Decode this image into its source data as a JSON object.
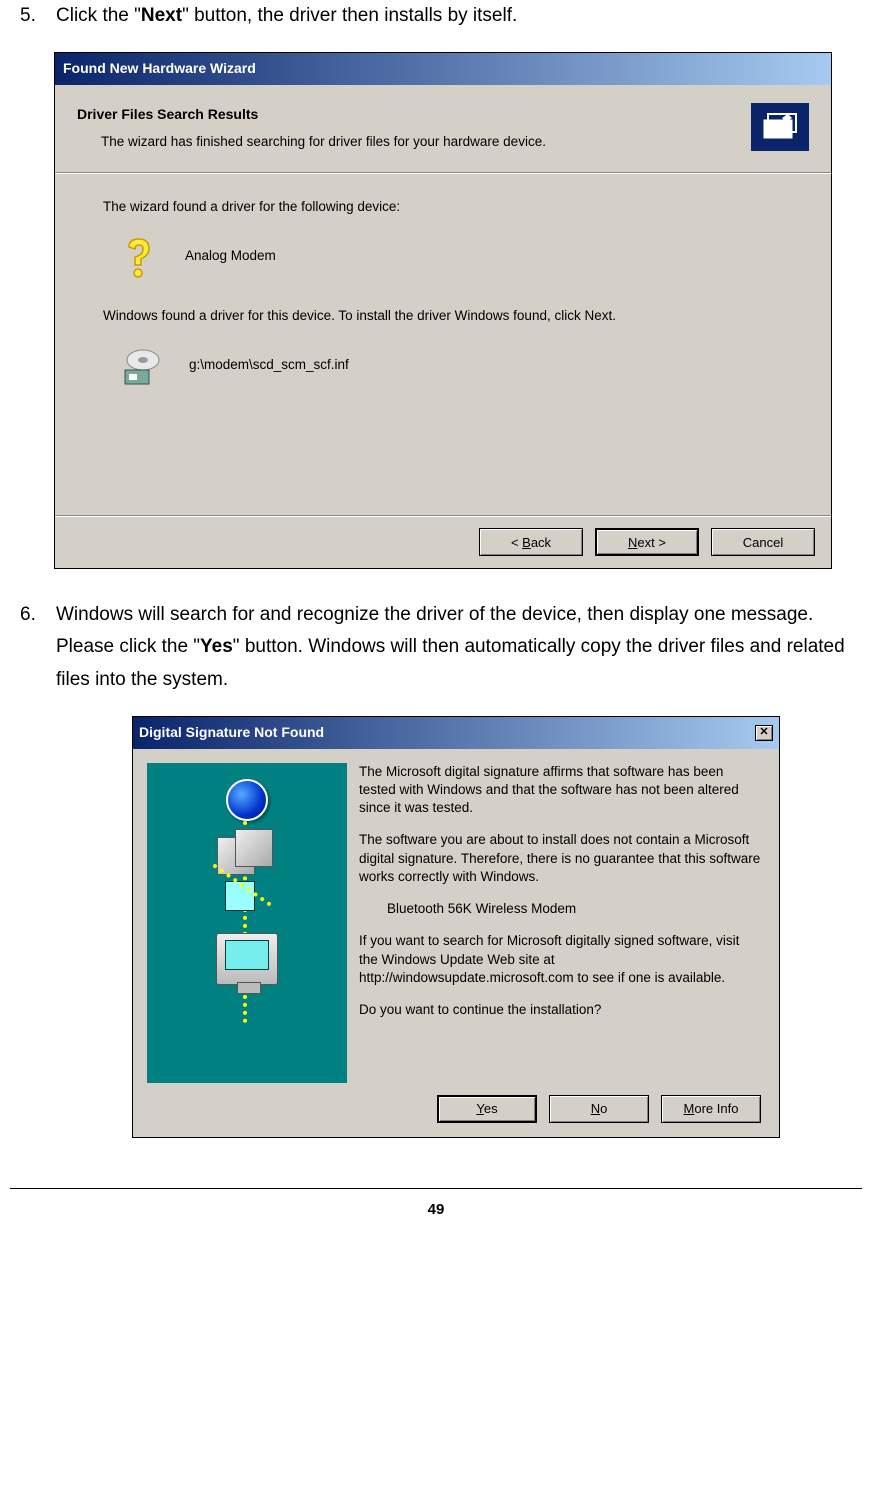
{
  "step5": {
    "num": "5.",
    "text_before": "Click the \"",
    "bold": "Next",
    "text_after": "\" button, the driver then installs by itself."
  },
  "dialog1": {
    "title": "Found New Hardware Wizard",
    "header_title": "Driver Files Search Results",
    "header_sub": "The wizard has finished searching for driver files for your hardware device.",
    "found_text": "The wizard found a driver for the following device:",
    "device_name": "Analog Modem",
    "install_text": "Windows found a driver for this device. To install the driver Windows found, click Next.",
    "driver_path": "g:\\modem\\scd_scm_scf.inf",
    "back_label": "Back",
    "next_label": "Next >",
    "cancel_label": "Cancel"
  },
  "step6": {
    "num": "6.",
    "text_before": "Windows will search for and recognize the driver of the device, then display one message. Please click the \"",
    "bold": "Yes",
    "text_after": "\" button. Windows will then automatically copy the driver files and related files into the system."
  },
  "dialog2": {
    "title": "Digital Signature Not Found",
    "para1": "The Microsoft digital signature affirms that software has been tested with Windows and that the software has not been altered since it was tested.",
    "para2": "The software you are about to install does not contain a Microsoft digital signature. Therefore,  there is no guarantee that this software works correctly with Windows.",
    "device": "Bluetooth 56K Wireless Modem",
    "para3": "If you want to search for Microsoft digitally signed software, visit the Windows Update Web site at http://windowsupdate.microsoft.com to see if one is available.",
    "para4": "Do you want to continue the installation?",
    "yes_label": "Yes",
    "no_label": "No",
    "more_label": "More Info"
  },
  "page_number": "49"
}
